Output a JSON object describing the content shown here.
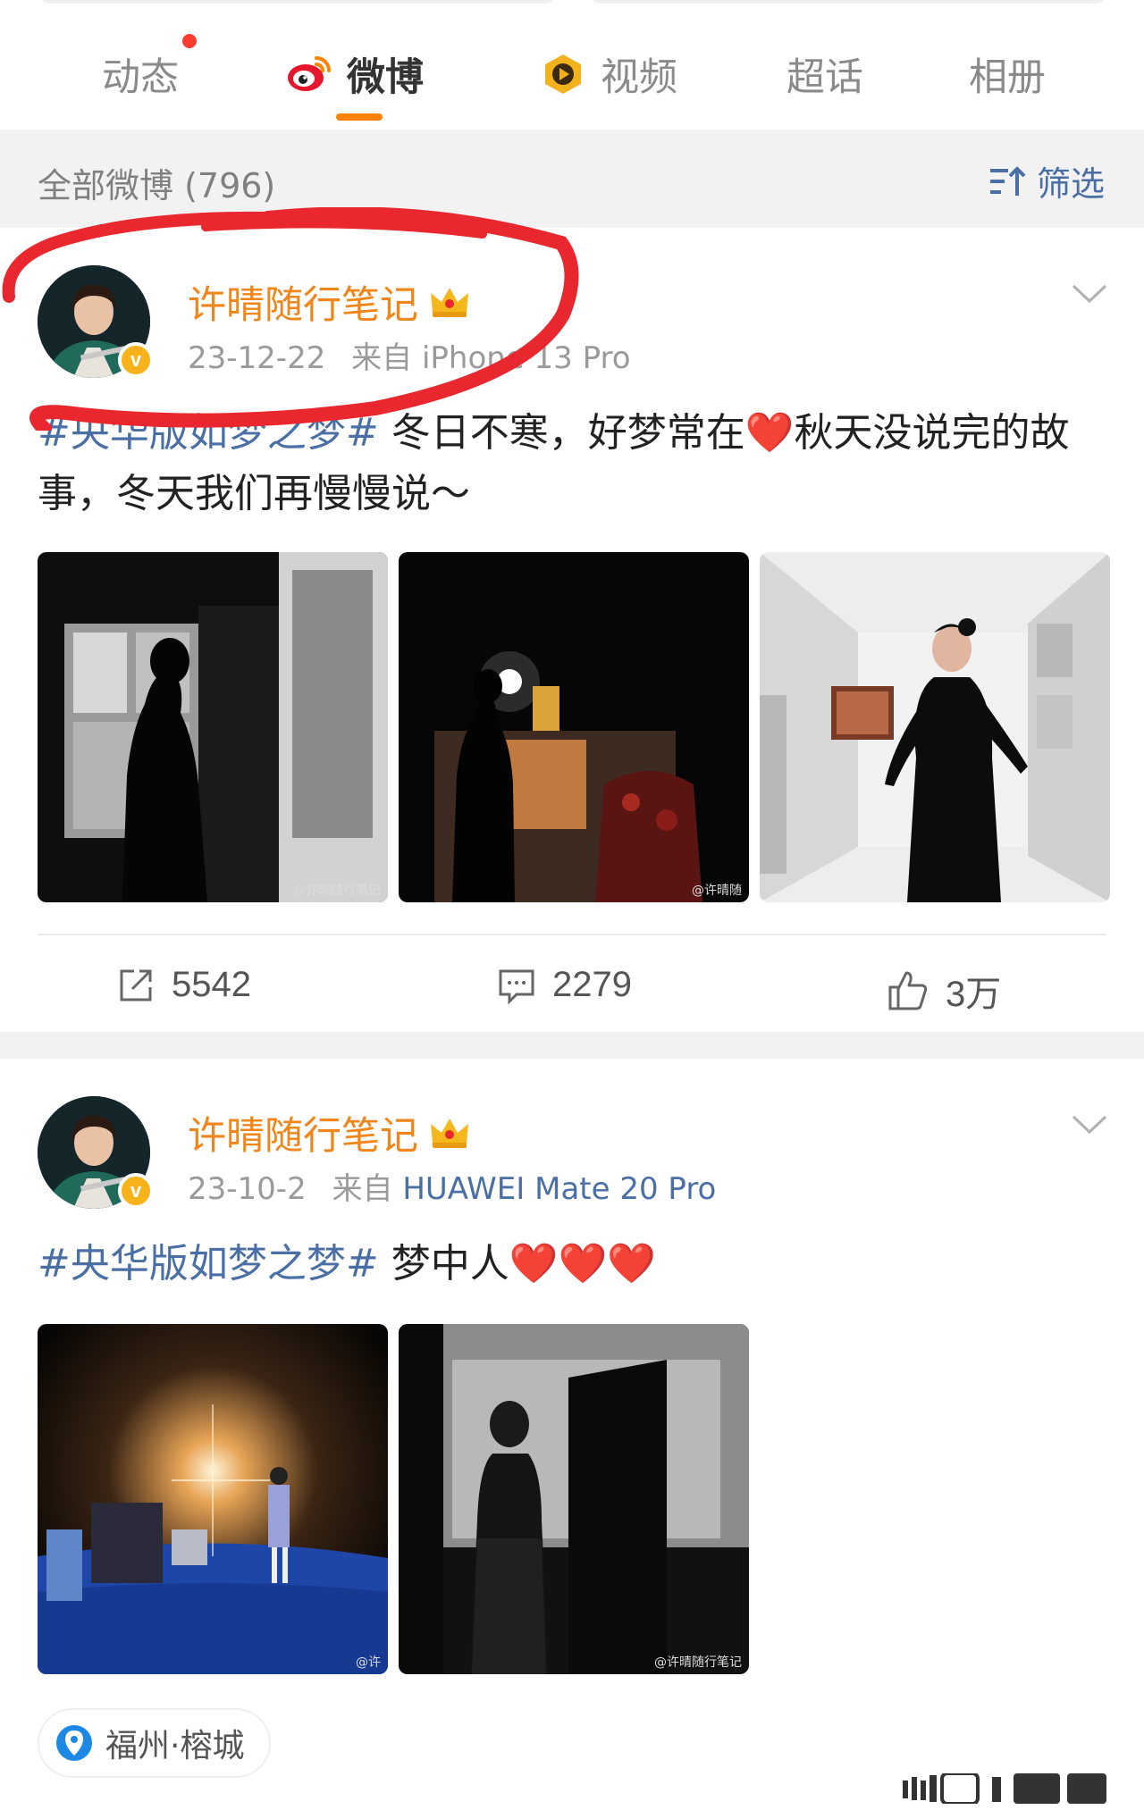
{
  "tabs": [
    {
      "label": "动态",
      "has_dot": true
    },
    {
      "label": "微博",
      "active": true,
      "icon": "weibo-logo-icon"
    },
    {
      "label": "视频",
      "icon": "video-play-icon"
    },
    {
      "label": "超话"
    },
    {
      "label": "相册"
    }
  ],
  "filter": {
    "title": "全部微博 (796)",
    "button_label": "筛选",
    "icon": "filter-sort-icon"
  },
  "posts": [
    {
      "author": "许晴随行笔记",
      "badge": "crown-icon",
      "verified_mark": "v",
      "date": "23-12-22",
      "source_prefix": "来自",
      "source": "iPhone 13 Pro",
      "hashtag": "#央华版如梦之梦#",
      "text": " 冬日不寒，好梦常在❤️秋天没说完的故事，冬天我们再慢慢说～",
      "images": [
        {
          "desc": "backstage-silhouette-window",
          "watermark": "@许晴随行笔记"
        },
        {
          "desc": "stage-silhouette-lights",
          "watermark": "@许晴随"
        },
        {
          "desc": "corridor-black-dress",
          "watermark": ""
        }
      ],
      "actions": {
        "reposts": "5542",
        "comments": "2279",
        "likes": "3万"
      }
    },
    {
      "author": "许晴随行笔记",
      "badge": "crown-icon",
      "verified_mark": "v",
      "date": "23-10-2",
      "source_prefix": "来自",
      "source": "HUAWEI Mate 20 Pro",
      "hashtag": "#央华版如梦之梦#",
      "text": " 梦中人❤️❤️❤️",
      "images": [
        {
          "desc": "stage-blue-floor-light",
          "watermark": "@许"
        },
        {
          "desc": "backstage-door-silhouette",
          "watermark": "@许晴随行笔记"
        }
      ],
      "location": "福州·榕城"
    }
  ],
  "colors": {
    "accent_orange": "#ff8200",
    "username_orange": "#f08519",
    "link_blue": "#4a6fa5",
    "annotation_red": "#e8282e"
  }
}
